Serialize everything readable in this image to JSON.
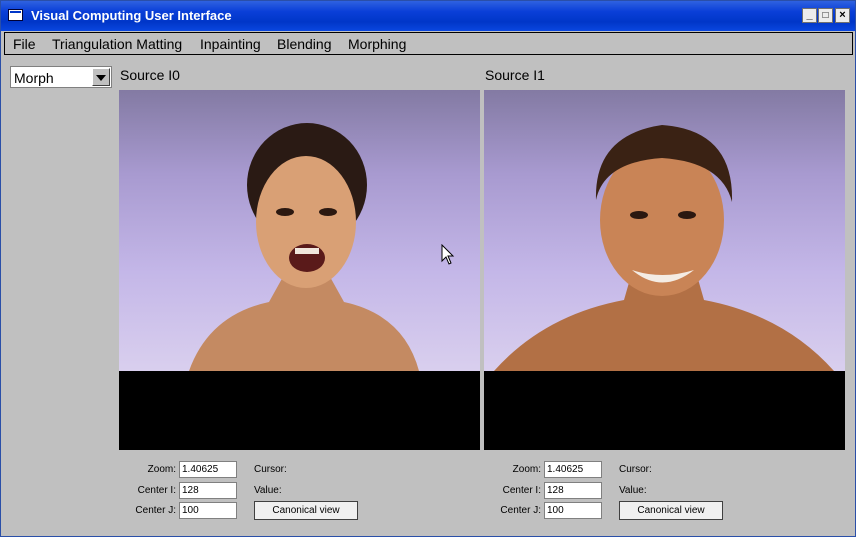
{
  "window": {
    "title": "Visual Computing User Interface"
  },
  "menu": [
    "File",
    "Triangulation Matting",
    "Inpainting",
    "Blending",
    "Morphing"
  ],
  "mode_select": {
    "value": "Morph"
  },
  "panels": [
    {
      "caption": "Source I0",
      "zoom_label": "Zoom:",
      "zoom": "1.40625",
      "center_i_label": "Center I:",
      "center_i": "128",
      "center_j_label": "Center J:",
      "center_j": "100",
      "cursor_label": "Cursor:",
      "value_label": "Value:",
      "canonical_button": "Canonical view"
    },
    {
      "caption": "Source I1",
      "zoom_label": "Zoom:",
      "zoom": "1.40625",
      "center_i_label": "Center I:",
      "center_i": "128",
      "center_j_label": "Center J:",
      "center_j": "100",
      "cursor_label": "Cursor:",
      "value_label": "Value:",
      "canonical_button": "Canonical view"
    }
  ],
  "colors": {
    "titlebar": "#0036c8",
    "background": "#c0c0c0",
    "image_background": "#a89ad0"
  }
}
